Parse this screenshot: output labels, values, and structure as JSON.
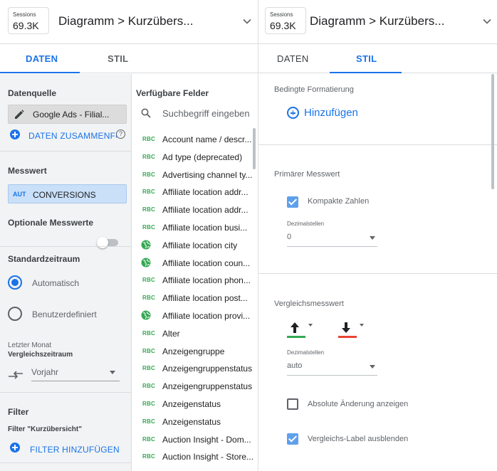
{
  "header": {
    "badge_label": "Sessions",
    "badge_value": "69.3K",
    "title": "Diagramm > Kurzübers..."
  },
  "tabs": [
    {
      "label": "DATEN"
    },
    {
      "label": "STIL"
    }
  ],
  "data_tab": {
    "datasource_title": "Datenquelle",
    "datasource_name": "Google Ads - Filial...",
    "blend_label": "DATEN ZUSAMMENFÜ",
    "metric_title": "Messwert",
    "metric_type": "AUT",
    "metric_name": "CONVERSIONS",
    "optional_metrics_title": "Optionale Messwerte",
    "optional_metrics_enabled": false,
    "date_range_title": "Standardzeitraum",
    "date_options": [
      {
        "label": "Automatisch",
        "selected": true
      },
      {
        "label": "Benutzerdefiniert",
        "selected": false
      }
    ],
    "last_month_label": "Letzter Monat",
    "comparison_title": "Vergleichszeitraum",
    "comparison_value": "Vorjahr",
    "filter_title": "Filter",
    "filter_subtitle": "Filter \"Kurzübersicht\"",
    "add_filter_label": "FILTER HINZUFÜGEN"
  },
  "fields": {
    "title": "Verfügbare Felder",
    "search_placeholder": "Suchbegriff eingeben",
    "items": [
      {
        "type": "text",
        "type_label": "RBC",
        "name": "Account name / descr..."
      },
      {
        "type": "text",
        "type_label": "RBC",
        "name": "Ad type (deprecated)"
      },
      {
        "type": "text",
        "type_label": "RBC",
        "name": "Advertising channel ty..."
      },
      {
        "type": "text",
        "type_label": "RBC",
        "name": "Affiliate location addr..."
      },
      {
        "type": "text",
        "type_label": "RBC",
        "name": "Affiliate location addr..."
      },
      {
        "type": "text",
        "type_label": "RBC",
        "name": "Affiliate location busi..."
      },
      {
        "type": "geo",
        "type_label": "",
        "name": "Affiliate location city"
      },
      {
        "type": "geo",
        "type_label": "",
        "name": "Affiliate location coun..."
      },
      {
        "type": "text",
        "type_label": "RBC",
        "name": "Affiliate location phon..."
      },
      {
        "type": "text",
        "type_label": "RBC",
        "name": "Affiliate location post..."
      },
      {
        "type": "geo",
        "type_label": "",
        "name": "Affiliate location provi..."
      },
      {
        "type": "text",
        "type_label": "RBC",
        "name": "Alter"
      },
      {
        "type": "text",
        "type_label": "RBC",
        "name": "Anzeigengruppe"
      },
      {
        "type": "text",
        "type_label": "RBC",
        "name": "Anzeigengruppenstatus"
      },
      {
        "type": "text",
        "type_label": "RBC",
        "name": "Anzeigengruppenstatus"
      },
      {
        "type": "text",
        "type_label": "RBC",
        "name": "Anzeigenstatus"
      },
      {
        "type": "text",
        "type_label": "RBC",
        "name": "Anzeigenstatus"
      },
      {
        "type": "text",
        "type_label": "RBC",
        "name": "Auction Insight - Dom..."
      },
      {
        "type": "text",
        "type_label": "RBC",
        "name": "Auction Insight - Store..."
      }
    ]
  },
  "style_tab": {
    "conditional_title": "Bedingte Formatierung",
    "add_label": "Hinzufügen",
    "primary_metric_title": "Primärer Messwert",
    "compact_numbers_label": "Kompakte Zahlen",
    "compact_numbers_checked": true,
    "decimals_label": "Dezimalstellen",
    "decimals_value": "0",
    "comparison_metric_title": "Vergleichsmesswert",
    "positive_color": "#34a853",
    "negative_color": "#ea4335",
    "comparison_decimals_label": "Dezimalstellen",
    "comparison_decimals_value": "auto",
    "absolute_change_label": "Absolute Änderung anzeigen",
    "absolute_change_checked": false,
    "hide_label_label": "Vergleichs-Label ausblenden",
    "hide_label_checked": true
  },
  "colors": {
    "accent": "#1a73e8",
    "sidebar_bg": "#f1f3f4",
    "field_type_green": "#34a853"
  }
}
